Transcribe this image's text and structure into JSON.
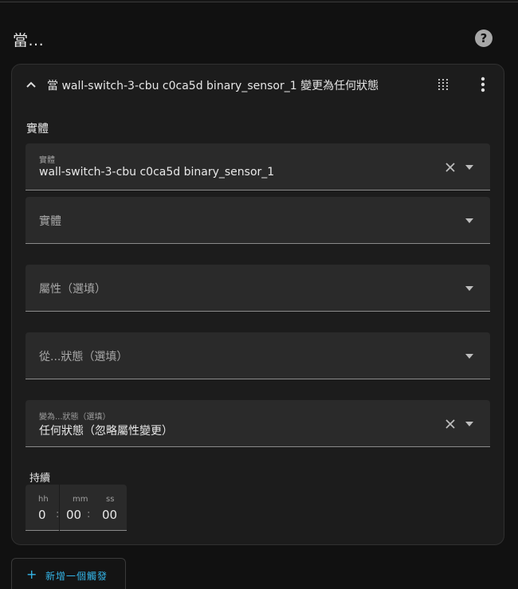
{
  "section": {
    "title": "當..."
  },
  "help": {
    "icon": "help-circle-icon",
    "glyph": "?"
  },
  "trigger": {
    "title": "當 wall-switch-3-cbu c0ca5d binary_sensor_1 變更為任何狀態",
    "subheading": "實體",
    "entity_field": {
      "label": "實體",
      "value": "wall-switch-3-cbu c0ca5d binary_sensor_1"
    },
    "entity_add_field": {
      "placeholder": "實體"
    },
    "attribute_field": {
      "placeholder": "屬性（選填）"
    },
    "from_field": {
      "placeholder": "從...狀態（選填）"
    },
    "to_field": {
      "label": "變為...狀態（選填）",
      "value": "任何狀態（忽略屬性變更）"
    },
    "duration": {
      "label": "持續",
      "hh_label": "hh",
      "hh_value": "0",
      "mm_label": "mm",
      "mm_value": "00",
      "ss_label": "ss",
      "ss_value": "00",
      "separator": ":"
    }
  },
  "add_trigger": {
    "plus": "+",
    "label": "新增一個觸發"
  },
  "colors": {
    "accent": "#34b5e8",
    "background": "#111111",
    "card": "#1c1c1c",
    "field": "#2a2a2a"
  }
}
